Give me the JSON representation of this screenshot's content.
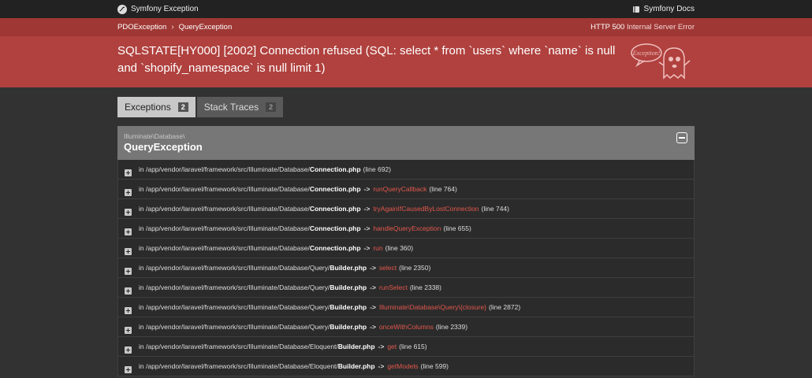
{
  "topbar": {
    "brand": "Symfony Exception",
    "docs": "Symfony Docs"
  },
  "breadcrumb": {
    "items": [
      "PDOException",
      "QueryException"
    ]
  },
  "status": {
    "code": "HTTP 500",
    "text": "Internal Server Error"
  },
  "message": "SQLSTATE[HY000] [2002] Connection refused (SQL: select * from `users` where `name` is null and `shopify_namespace` is null limit 1)",
  "ghost_label": "Exception!",
  "tabs": [
    {
      "label": "Exceptions",
      "count": "2"
    },
    {
      "label": "Stack Traces",
      "count": "2"
    }
  ],
  "exception": {
    "namespace": "Illuminate\\Database\\",
    "class": "QueryException"
  },
  "trace": [
    {
      "prefix": "in /app/vendor/laravel/framework/src/Illuminate/Database/",
      "file": "Connection.php",
      "func": "",
      "line": "(line 692)"
    },
    {
      "prefix": "in /app/vendor/laravel/framework/src/Illuminate/Database/",
      "file": "Connection.php",
      "func": "runQueryCallback",
      "line": "(line 764)"
    },
    {
      "prefix": "in /app/vendor/laravel/framework/src/Illuminate/Database/",
      "file": "Connection.php",
      "func": "tryAgainIfCausedByLostConnection",
      "line": "(line 744)"
    },
    {
      "prefix": "in /app/vendor/laravel/framework/src/Illuminate/Database/",
      "file": "Connection.php",
      "func": "handleQueryException",
      "line": "(line 655)"
    },
    {
      "prefix": "in /app/vendor/laravel/framework/src/Illuminate/Database/",
      "file": "Connection.php",
      "func": "run",
      "line": "(line 360)"
    },
    {
      "prefix": "in /app/vendor/laravel/framework/src/Illuminate/Database/Query/",
      "file": "Builder.php",
      "func": "select",
      "line": "(line 2350)"
    },
    {
      "prefix": "in /app/vendor/laravel/framework/src/Illuminate/Database/Query/",
      "file": "Builder.php",
      "func": "runSelect",
      "line": "(line 2338)"
    },
    {
      "prefix": "in /app/vendor/laravel/framework/src/Illuminate/Database/Query/",
      "file": "Builder.php",
      "func": "Illuminate\\Database\\Query\\{closure}",
      "line": "(line 2872)"
    },
    {
      "prefix": "in /app/vendor/laravel/framework/src/Illuminate/Database/Query/",
      "file": "Builder.php",
      "func": "onceWithColumns",
      "line": "(line 2339)"
    },
    {
      "prefix": "in /app/vendor/laravel/framework/src/Illuminate/Database/Eloquent/",
      "file": "Builder.php",
      "func": "get",
      "line": "(line 615)"
    },
    {
      "prefix": "in /app/vendor/laravel/framework/src/Illuminate/Database/Eloquent/",
      "file": "Builder.php",
      "func": "getModels",
      "line": "(line 599)"
    }
  ],
  "trace_arrow": "->",
  "colors": {
    "header": "#b0413e",
    "function": "#e2574c"
  }
}
